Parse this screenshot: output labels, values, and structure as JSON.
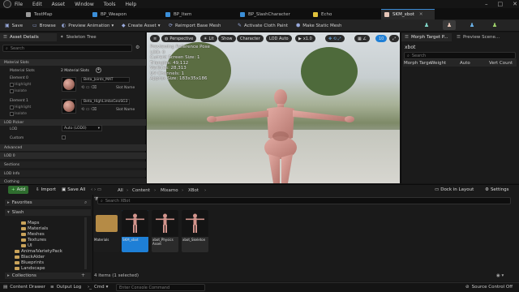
{
  "menu": [
    "File",
    "Edit",
    "Asset",
    "Window",
    "Tools",
    "Help"
  ],
  "tabs": [
    {
      "label": "TestMap",
      "color": "#b0b0b0"
    },
    {
      "label": "BP_Weapon",
      "color": "#3b8ed8"
    },
    {
      "label": "BP_Item",
      "color": "#3b8ed8"
    },
    {
      "label": "BP_SlashCharacter",
      "color": "#3b8ed8"
    },
    {
      "label": "Echo",
      "color": "#e0c23c"
    },
    {
      "label": "SKM_xbot",
      "color": "#e6c6b8"
    }
  ],
  "toolbar": {
    "save": "Save",
    "browse": "Browse",
    "preview_animation": "Preview Animation",
    "create_asset": "Create Asset",
    "reimport": "Reimport Base Mesh",
    "cloth_paint": "Activate Cloth Paint",
    "make_static": "Make Static Mesh",
    "preview_scene": "Preview Scene..."
  },
  "left_panel": {
    "tab_details": "Asset Details",
    "tab_skeleton": "Skeleton Tree",
    "search_placeholder": "Search",
    "material_slots_header": "Material Slots",
    "material_slots_label": "Material Slots",
    "material_slots_count": "2 Material Slots",
    "element0": {
      "label": "Element 0",
      "highlight": "Highlight",
      "isolate": "Isolate",
      "material": "Beta_Joints_MAT",
      "slot_name": "Slot Name"
    },
    "element1": {
      "label": "Element 1",
      "highlight": "Highlight",
      "isolate": "Isolate",
      "material": "Beta_HighLimbsGeoSG3",
      "slot_name": "Slot Name"
    },
    "lod_picker_header": "LOD Picker",
    "lod_label": "LOD",
    "lod_value": "Auto (LOD0)",
    "custom_label": "Custom",
    "sections": [
      "Advanced",
      "LOD 0",
      "Sections",
      "LOD Info",
      "Clothing"
    ]
  },
  "viewport": {
    "perspective": "Perspective",
    "lit": "Lit",
    "show": "Show",
    "character": "Character",
    "lod_auto": "LOD Auto",
    "play_speed": "x1.0",
    "grid_size": "10",
    "stats": [
      "Previewing Reference Pose",
      "LOD: 0",
      "Current Screen Size: 1",
      "Triangles: 49,112",
      "Vertices: 28,313",
      "UV Channels: 1",
      "Approx Size: 183x35x186"
    ]
  },
  "right_panel": {
    "tab_morph": "Morph Target P...",
    "tab_preview": "Preview Scene...",
    "asset_name": "xbot",
    "search_placeholder": "Search",
    "columns": [
      "Morph Targe",
      "Weight",
      "Auto",
      "Vert Count"
    ]
  },
  "content_browser": {
    "add": "Add",
    "import": "Import",
    "save_all": "Save All",
    "path": [
      "All",
      "Content",
      "Mixamo",
      "XBot"
    ],
    "dock_in_layout": "Dock in Layout",
    "settings": "Settings",
    "favorites": "Favorites",
    "project": "Slash",
    "folders": [
      "Maps",
      "Materials",
      "Meshes",
      "Textures",
      "UI",
      "AnimalVarietyPack",
      "BlackAlder",
      "Blueprints",
      "Landscape"
    ],
    "collections": "Collections",
    "search_placeholder": "Search XBot",
    "assets": [
      {
        "name": "Materials",
        "kind": "folder"
      },
      {
        "name": "SKM_xbot",
        "kind": "mesh"
      },
      {
        "name": "xbot_Physics Asset",
        "kind": "physics"
      },
      {
        "name": "xbot_Skeleton",
        "kind": "skeleton"
      }
    ],
    "item_count": "4 items (1 selected)"
  },
  "status_bar": {
    "content_drawer": "Content Drawer",
    "output_log": "Output Log",
    "cmd": "Cmd",
    "console_placeholder": "Enter Console Command",
    "source_control": "Source Control Off"
  },
  "colors": {
    "accent": "#1e7fd6",
    "add_button": "#2f6d2f",
    "folder": "#c9a35a",
    "mesh_skin": "#d3948c"
  }
}
